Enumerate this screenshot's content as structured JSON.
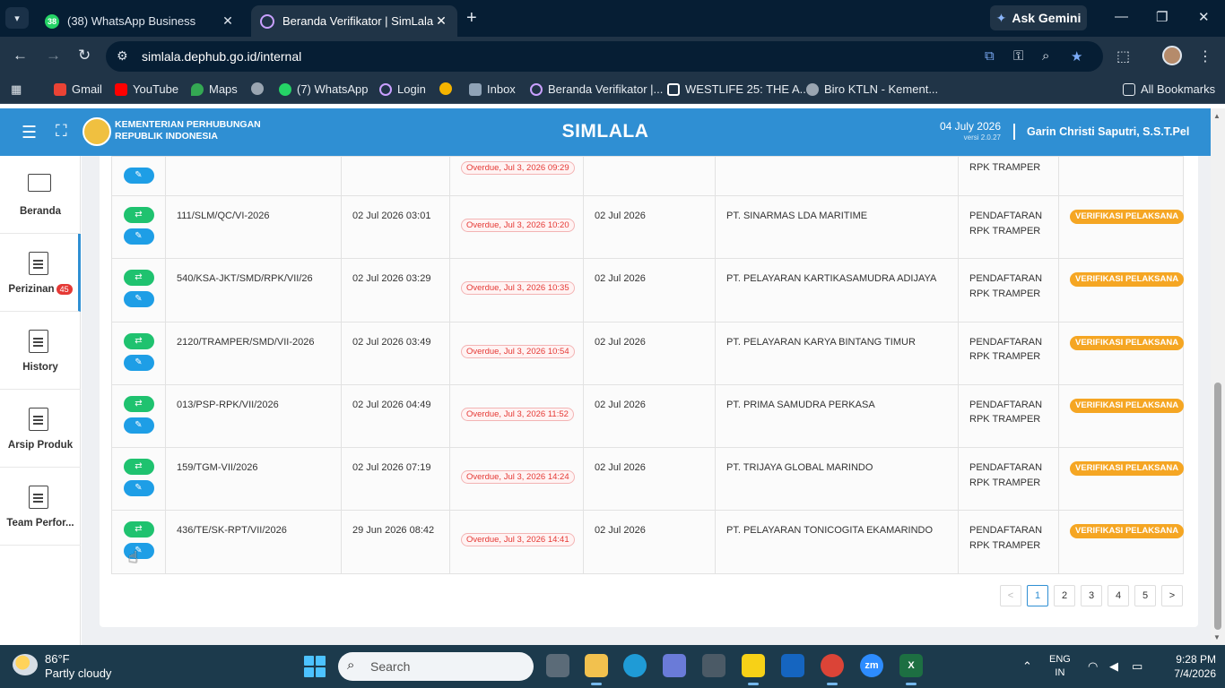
{
  "browser": {
    "tabs": [
      {
        "title": "(38) WhatsApp Business",
        "favicon": "38",
        "active": false
      },
      {
        "title": "Beranda Verifikator | SimLala",
        "favicon": "",
        "active": true
      }
    ],
    "ask_gemini": "Ask Gemini",
    "url": "simlala.dephub.go.id/internal",
    "bookmarks": [
      {
        "label": "Gmail",
        "color": "#ea4335"
      },
      {
        "label": "YouTube",
        "color": "#ff0000"
      },
      {
        "label": "Maps",
        "color": "#34a853"
      },
      {
        "label": "",
        "color": "#9aa5b1"
      },
      {
        "label": "(7) WhatsApp",
        "color": "#25d366"
      },
      {
        "label": "Login",
        "color": "#c9a0ff"
      },
      {
        "label": "",
        "color": "#f4b400"
      },
      {
        "label": "Inbox",
        "color": "#8fa3b7"
      },
      {
        "label": "Beranda Verifikator |...",
        "color": "#c9a0ff"
      },
      {
        "label": "WESTLIFE 25: THE A...",
        "color": "#ffffff"
      },
      {
        "label": "Biro KTLN - Kement...",
        "color": "#9aa5b1"
      }
    ],
    "all_bookmarks": "All Bookmarks"
  },
  "app": {
    "ministry_line1": "KEMENTERIAN PERHUBUNGAN",
    "ministry_line2": "REPUBLIK INDONESIA",
    "title": "SIMLALA",
    "date": "04 July 2026",
    "version": "versi 2.0.27",
    "user": "Garin Christi Saputri, S.S.T.Pel",
    "header_color": "#2f8fd3"
  },
  "sidebar": {
    "items": [
      {
        "label": "Beranda",
        "icon": "monitor-icon"
      },
      {
        "label": "Perizinan",
        "icon": "document-icon",
        "badge": "45"
      },
      {
        "label": "History",
        "icon": "document-icon"
      },
      {
        "label": "Arsip Produk",
        "icon": "document-icon"
      },
      {
        "label": "Team Perfor...",
        "icon": "document-icon"
      }
    ]
  },
  "table": {
    "partial_row": {
      "overdue": "Overdue, Jul 3, 2026 09:29",
      "type": "RPK TRAMPER"
    },
    "rows": [
      {
        "number": "111/SLM/QC/VI-2026",
        "submitted": "02 Jul 2026 03:01",
        "overdue": "Overdue, Jul 3, 2026 10:20",
        "date": "02 Jul 2026",
        "company": "PT. SINARMAS LDA MARITIME",
        "type_line1": "PENDAFTARAN",
        "type_line2": "RPK TRAMPER",
        "status": "VERIFIKASI PELAKSANA"
      },
      {
        "number": "540/KSA-JKT/SMD/RPK/VII/26",
        "submitted": "02 Jul 2026 03:29",
        "overdue": "Overdue, Jul 3, 2026 10:35",
        "date": "02 Jul 2026",
        "company": "PT. PELAYARAN KARTIKASAMUDRA ADIJAYA",
        "type_line1": "PENDAFTARAN",
        "type_line2": "RPK TRAMPER",
        "status": "VERIFIKASI PELAKSANA"
      },
      {
        "number": "2120/TRAMPER/SMD/VII-2026",
        "submitted": "02 Jul 2026 03:49",
        "overdue": "Overdue, Jul 3, 2026 10:54",
        "date": "02 Jul 2026",
        "company": "PT. PELAYARAN KARYA BINTANG TIMUR",
        "type_line1": "PENDAFTARAN",
        "type_line2": "RPK TRAMPER",
        "status": "VERIFIKASI PELAKSANA"
      },
      {
        "number": "013/PSP-RPK/VII/2026",
        "submitted": "02 Jul 2026 04:49",
        "overdue": "Overdue, Jul 3, 2026 11:52",
        "date": "02 Jul 2026",
        "company": "PT. PRIMA SAMUDRA PERKASA",
        "type_line1": "PENDAFTARAN",
        "type_line2": "RPK TRAMPER",
        "status": "VERIFIKASI PELAKSANA"
      },
      {
        "number": "159/TGM-VII/2026",
        "submitted": "02 Jul 2026 07:19",
        "overdue": "Overdue, Jul 3, 2026 14:24",
        "date": "02 Jul 2026",
        "company": "PT. TRIJAYA GLOBAL MARINDO",
        "type_line1": "PENDAFTARAN",
        "type_line2": "RPK TRAMPER",
        "status": "VERIFIKASI PELAKSANA"
      },
      {
        "number": "436/TE/SK-RPT/VII/2026",
        "submitted": "29 Jun 2026 08:42",
        "overdue": "Overdue, Jul 3, 2026 14:41",
        "date": "02 Jul 2026",
        "company": "PT. PELAYARAN TONICOGITA EKAMARINDO",
        "type_line1": "PENDAFTARAN",
        "type_line2": "RPK TRAMPER",
        "status": "VERIFIKASI PELAKSANA"
      }
    ]
  },
  "pagination": {
    "prev": "<",
    "pages": [
      "1",
      "2",
      "3",
      "4",
      "5"
    ],
    "next": ">",
    "current": "1"
  },
  "taskbar": {
    "temperature": "86°F",
    "weather": "Partly cloudy",
    "search_placeholder": "Search",
    "language_line1": "ENG",
    "language_line2": "IN",
    "time": "9:28 PM",
    "date": "7/4/2026"
  }
}
